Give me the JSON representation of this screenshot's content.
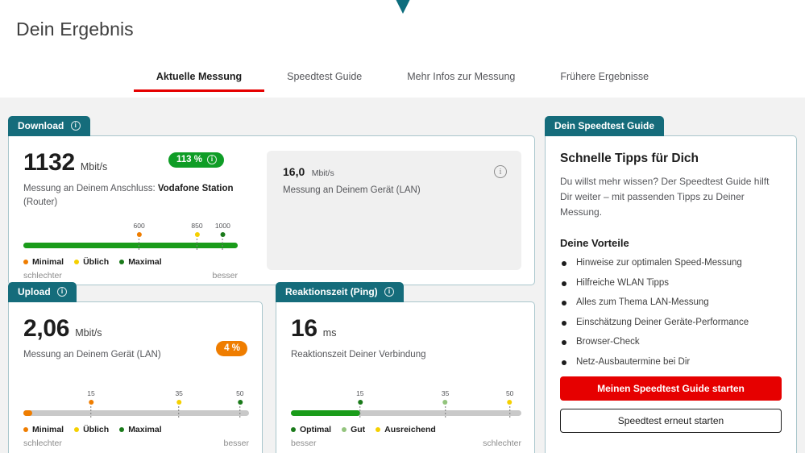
{
  "header": {
    "title": "Dein Ergebnis",
    "chevron_icon": "chevron-down-icon",
    "accent_color": "#0d6d7d"
  },
  "tabs": [
    {
      "label": "Aktuelle Messung",
      "active": true
    },
    {
      "label": "Speedtest Guide",
      "active": false
    },
    {
      "label": "Mehr Infos zur Messung",
      "active": false
    },
    {
      "label": "Frühere Ergebnisse",
      "active": false
    }
  ],
  "colors": {
    "tab_header": "#156c7b",
    "brand_red": "#e60000",
    "green": "#1a9c1a",
    "badge_green": "#0f9d26",
    "badge_orange": "#ef7d00",
    "yellow": "#f5d000",
    "orange": "#ef7d00",
    "track_grey": "#c9c9c9"
  },
  "download_card": {
    "tab_label": "Download",
    "tab_info_icon": "info-icon",
    "value": "1132",
    "unit": "Mbit/s",
    "badge": {
      "text": "113 %",
      "color": "green",
      "info_icon": "info-icon"
    },
    "sub_prefix": "Messung an Deinem Anschluss: ",
    "sub_strong": "Vodafone Station",
    "sub_suffix": "(Router)",
    "chart_data": {
      "type": "bar",
      "title": "Download Mbit/s",
      "value": 1132,
      "fill_percent": 100,
      "markers": [
        {
          "label": "600",
          "value": 600,
          "pos_percent": 54,
          "color": "#ef7d00",
          "legend": "Minimal"
        },
        {
          "label": "850",
          "value": 850,
          "pos_percent": 81,
          "color": "#f5d000",
          "legend": "Üblich"
        },
        {
          "label": "1000",
          "value": 1000,
          "pos_percent": 93,
          "color": "#1a7a1a",
          "legend": "Maximal"
        }
      ],
      "legend": [
        {
          "label": "Minimal",
          "color": "#ef7d00"
        },
        {
          "label": "Üblich",
          "color": "#f5d000"
        },
        {
          "label": "Maximal",
          "color": "#1a7a1a"
        }
      ],
      "left_label": "schlechter",
      "right_label": "besser"
    }
  },
  "lan_panel": {
    "value": "16,0",
    "unit": "Mbit/s",
    "sub": "Messung an Deinem Gerät (LAN)",
    "info_icon": "info-icon"
  },
  "upload_card": {
    "tab_label": "Upload",
    "tab_info_icon": "info-icon",
    "value": "2,06",
    "unit": "Mbit/s",
    "badge": {
      "text": "4 %",
      "color": "orange"
    },
    "sub": "Messung an Deinem Gerät (LAN)",
    "chart_data": {
      "type": "bar",
      "title": "Upload Mbit/s",
      "value": 2.06,
      "fill_percent": 4,
      "markers": [
        {
          "label": "15",
          "value": 15,
          "pos_percent": 30,
          "color": "#ef7d00",
          "legend": "Minimal"
        },
        {
          "label": "35",
          "value": 35,
          "pos_percent": 69,
          "color": "#f5d000",
          "legend": "Üblich"
        },
        {
          "label": "50",
          "value": 50,
          "pos_percent": 96,
          "color": "#1a7a1a",
          "legend": "Maximal"
        }
      ],
      "legend": [
        {
          "label": "Minimal",
          "color": "#ef7d00"
        },
        {
          "label": "Üblich",
          "color": "#f5d000"
        },
        {
          "label": "Maximal",
          "color": "#1a7a1a"
        }
      ],
      "left_label": "schlechter",
      "right_label": "besser"
    }
  },
  "ping_card": {
    "tab_label": "Reaktionszeit (Ping)",
    "tab_info_icon": "info-icon",
    "value": "16",
    "unit": "ms",
    "sub": "Reaktionszeit Deiner Verbindung",
    "chart_data": {
      "type": "bar",
      "title": "Reaktionszeit ms",
      "value": 16,
      "fill_percent": 30,
      "markers": [
        {
          "label": "15",
          "value": 15,
          "pos_percent": 30,
          "color": "#1a7a1a",
          "legend": "Optimal"
        },
        {
          "label": "35",
          "value": 35,
          "pos_percent": 67,
          "color": "#93c47d",
          "legend": "Gut"
        },
        {
          "label": "50",
          "value": 50,
          "pos_percent": 95,
          "color": "#f5d000",
          "legend": "Ausreichend"
        }
      ],
      "legend": [
        {
          "label": "Optimal",
          "color": "#1a7a1a"
        },
        {
          "label": "Gut",
          "color": "#93c47d"
        },
        {
          "label": "Ausreichend",
          "color": "#f5d000"
        }
      ],
      "left_label": "besser",
      "right_label": "schlechter"
    }
  },
  "guide_card": {
    "tab_label": "Dein Speedtest Guide",
    "heading": "Schnelle Tipps für Dich",
    "paragraph": "Du willst mehr wissen? Der Speedtest Guide hilft Dir weiter – mit passenden Tipps zu Deiner Messung.",
    "subheading": "Deine Vorteile",
    "benefits": [
      "Hinweise zur optimalen Speed-Messung",
      "Hilfreiche WLAN Tipps",
      "Alles zum Thema LAN-Messung",
      "Einschätzung Deiner Geräte-Performance",
      "Browser-Check",
      "Netz-Ausbautermine bei Dir"
    ],
    "primary_button": "Meinen Speedtest Guide starten",
    "secondary_button": "Speedtest erneut starten"
  }
}
